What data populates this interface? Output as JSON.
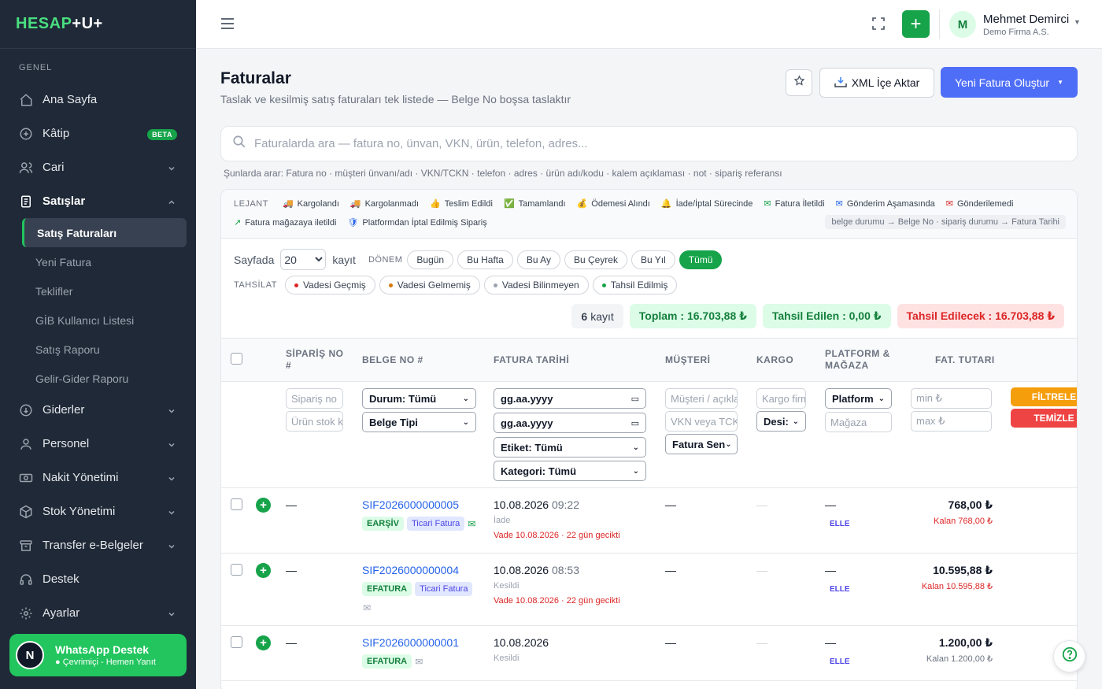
{
  "brand": {
    "a": "HESAP",
    "b": "+U+"
  },
  "sidebar": {
    "section": "GENEL",
    "items": [
      {
        "label": "Ana Sayfa"
      },
      {
        "label": "Kâtip",
        "badge": "BETA"
      },
      {
        "label": "Cari"
      },
      {
        "label": "Satışlar"
      },
      {
        "label": "Giderler"
      },
      {
        "label": "Personel"
      },
      {
        "label": "Nakit Yönetimi"
      },
      {
        "label": "Stok Yönetimi"
      },
      {
        "label": "Transfer e-Belgeler"
      },
      {
        "label": "Destek"
      },
      {
        "label": "Ayarlar"
      }
    ],
    "sales_sub": [
      "Satış Faturaları",
      "Yeni Fatura",
      "Teklifler",
      "GİB Kullanıcı Listesi",
      "Satış Raporu",
      "Gelir-Gider Raporu"
    ],
    "whatsapp": {
      "avatar": "N",
      "title": "WhatsApp Destek",
      "status": "● Çevrimiçi - Hemen Yanıt"
    }
  },
  "topbar": {
    "user_initial": "M",
    "user_name": "Mehmet Demirci",
    "company": "Demo Firma A.S."
  },
  "page": {
    "title": "Faturalar",
    "subtitle": "Taslak ve kesilmiş satış faturaları tek listede — Belge No boşsa taslaktır",
    "xml_label": "XML İçe Aktar",
    "new_label": "Yeni Fatura Oluştur"
  },
  "search": {
    "placeholder": "Faturalarda ara — fatura no, ünvan, VKN, ürün, telefon, adres...",
    "hint": "Şunlarda arar: Fatura no · müşteri ünvanı/adı · VKN/TCKN · telefon · adres · ürün adı/kodu · kalem açıklaması · not · sipariş referansı"
  },
  "legend": {
    "label": "LEJANT",
    "row1": [
      {
        "icon": "🚚",
        "label": "Kargolandı"
      },
      {
        "icon": "🚚",
        "label": "Kargolanmadı"
      },
      {
        "icon": "👍",
        "label": "Teslim Edildi"
      },
      {
        "icon": "✅",
        "label": "Tamamlandı"
      },
      {
        "icon": "💰",
        "label": "Ödemesi Alındı"
      },
      {
        "icon": "🔔",
        "label": "İade/İptal Sürecinde"
      },
      {
        "icon": "✉",
        "label": "Fatura İletildi"
      },
      {
        "icon": "✉",
        "label": "Gönderim Aşamasında"
      },
      {
        "icon": "✉",
        "label": "Gönderilemedi"
      }
    ],
    "row2": [
      {
        "icon": "↗",
        "label": "Fatura mağazaya iletildi"
      },
      {
        "icon": "🛡",
        "label": "Platformdan İptal Edilmiş Sipariş"
      }
    ],
    "note": "belge durumu → Belge No · sipariş durumu → Fatura Tarihi"
  },
  "controls": {
    "page_label": "Sayfada",
    "page_size": "20",
    "record_label": "kayıt",
    "period_label": "DÖNEM",
    "periods": [
      "Bugün",
      "Bu Hafta",
      "Bu Ay",
      "Bu Çeyrek",
      "Bu Yıl",
      "Tümü"
    ],
    "collection_label": "TAHSİLAT",
    "collections": [
      "Vadesi Geçmiş",
      "Vadesi Gelmemiş",
      "Vadesi Bilinmeyen",
      "Tahsil Edilmiş"
    ]
  },
  "stats": {
    "count": "6",
    "count_label": "kayıt",
    "total": "Toplam : 16.703,88 ₺",
    "collected": "Tahsil Edilen : 0,00 ₺",
    "to_collect": "Tahsil Edilecek : 16.703,88 ₺"
  },
  "table": {
    "headers": {
      "order": "SİPARİŞ NO #",
      "doc": "BELGE NO #",
      "date": "FATURA TARİHİ",
      "customer": "MÜŞTERİ",
      "cargo": "KARGO",
      "platform": "PLATFORM & MAĞAZA",
      "amount": "FAT. TUTARI"
    },
    "filters": {
      "order_ph": "Sipariş no",
      "stock_ph": "Ürün stok kodu",
      "status": "Durum: Tümü",
      "doc_type": "Belge Tipi",
      "date_ph": "gg.aa.yyyy",
      "tag": "Etiket: Tümü",
      "category": "Kategori: Tümü",
      "customer_ph": "Müşteri / açıklama",
      "vkn_ph": "VKN veya TCKN",
      "sender": "Fatura Sen",
      "cargo_ph": "Kargo firması",
      "desi": "Desi:",
      "platform": "Platform",
      "store_ph": "Mağaza",
      "min_ph": "min ₺",
      "max_ph": "max ₺",
      "filter_btn": "FİLTRELE",
      "clear_btn": "TEMİZLE"
    },
    "rows": [
      {
        "order": "—",
        "doc": "SIF2026000000005",
        "badges": [
          "EARŞİV",
          "Ticari Fatura"
        ],
        "date": "10.08.2026",
        "time": "09:22",
        "status": "İade",
        "due": "Vade 10.08.2026 · 22 gün gecikti",
        "customer": "—",
        "cargo": "—",
        "platform": "—",
        "store": "ELLE",
        "amount": "768,00 ₺",
        "remain": "Kalan 768,00 ₺"
      },
      {
        "order": "—",
        "doc": "SIF2026000000004",
        "badges": [
          "EFATURA",
          "Ticari Fatura"
        ],
        "date": "10.08.2026",
        "time": "08:53",
        "status": "Kesildi",
        "due": "Vade 10.08.2026 · 22 gün gecikti",
        "customer": "—",
        "cargo": "—",
        "platform": "—",
        "store": "ELLE",
        "amount": "10.595,88 ₺",
        "remain": "Kalan 10.595,88 ₺"
      },
      {
        "order": "—",
        "doc": "SIF2026000000001",
        "badges": [
          "EFATURA"
        ],
        "date": "10.08.2026",
        "time": "",
        "status": "Kesildi",
        "due": "",
        "customer": "—",
        "cargo": "—",
        "platform": "—",
        "store": "ELLE",
        "amount": "1.200,00 ₺",
        "remain": "Kalan 1.200,00 ₺"
      }
    ]
  }
}
